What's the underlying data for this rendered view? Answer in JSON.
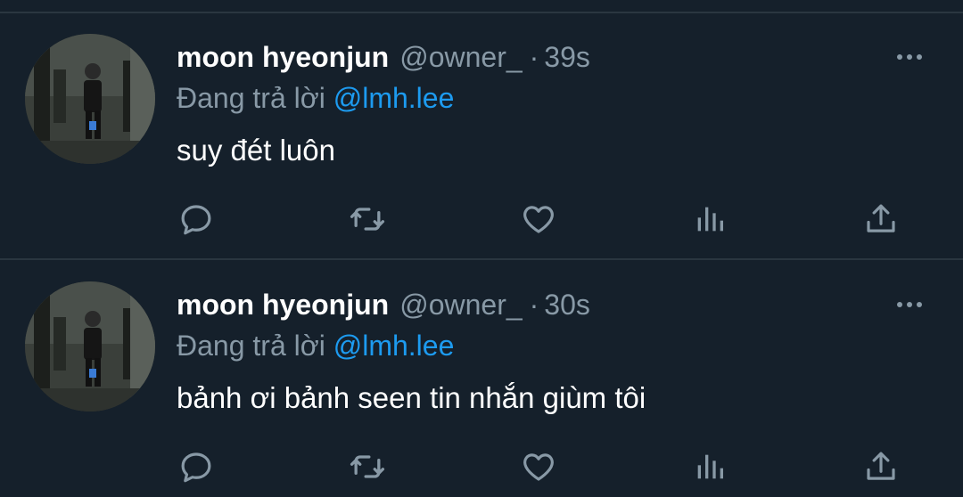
{
  "tweets": [
    {
      "author_name": "moon hyeonjun",
      "author_handle": "@owner_",
      "separator": "·",
      "time": "39s",
      "reply_prefix": "Đang trả lời",
      "reply_mention": "@lmh.lee",
      "text": "suy đét luôn"
    },
    {
      "author_name": "moon hyeonjun",
      "author_handle": "@owner_",
      "separator": "·",
      "time": "30s",
      "reply_prefix": "Đang trả lời",
      "reply_mention": "@lmh.lee",
      "text": "bảnh ơi bảnh seen tin nhắn giùm tôi"
    }
  ],
  "icons": {
    "more": "more-horizontal-icon",
    "reply": "reply-bubble-icon",
    "retweet": "retweet-icon",
    "like": "heart-icon",
    "views": "analytics-icon",
    "share": "share-icon"
  },
  "colors": {
    "background": "#15202b",
    "secondary_text": "#8899a6",
    "mention": "#1d9bf0",
    "divider": "#2a3640"
  }
}
